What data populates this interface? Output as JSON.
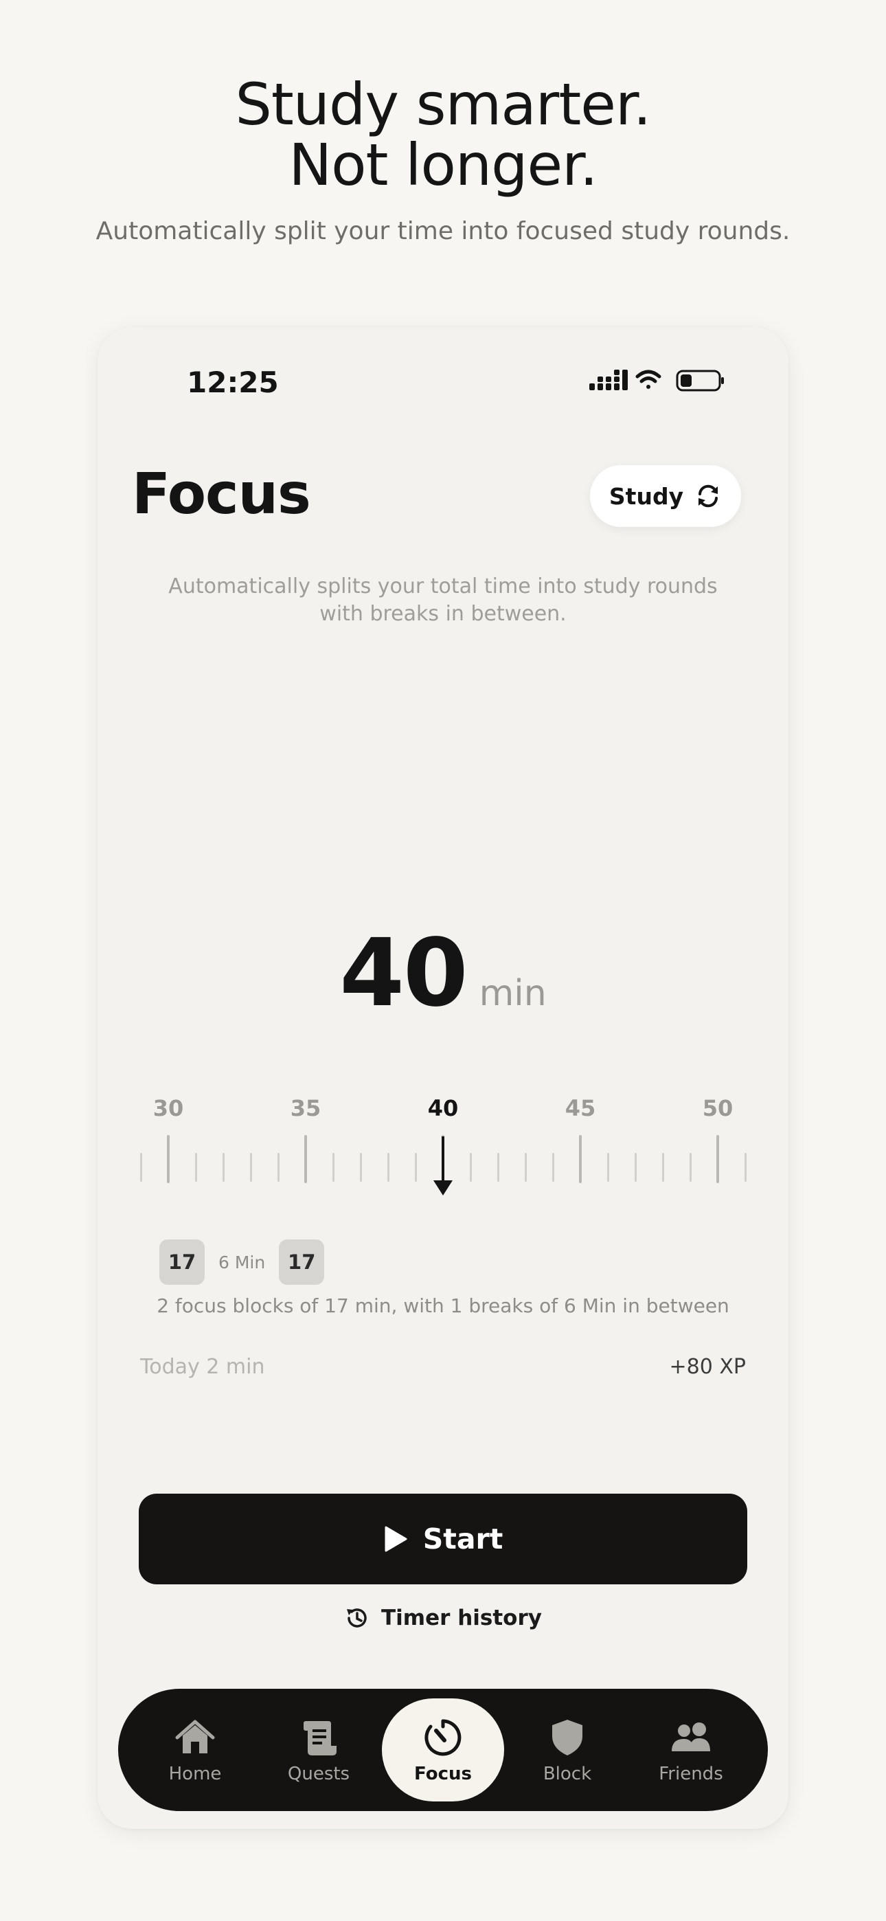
{
  "marketing": {
    "headline_line1": "Study smarter.",
    "headline_line2": "Not longer.",
    "subline": "Automatically split your time into focused study rounds."
  },
  "status_bar": {
    "time": "12:25",
    "icons": [
      "signal-icon",
      "wifi-icon",
      "battery-icon"
    ]
  },
  "header": {
    "title": "Focus",
    "mode_label": "Study",
    "mode_icon": "refresh-icon"
  },
  "description": "Automatically splits your total time into study rounds with breaks in between.",
  "timer": {
    "value": "40",
    "unit": "min"
  },
  "ruler": {
    "labels": [
      "30",
      "35",
      "40",
      "45",
      "50"
    ],
    "selected": "40",
    "min": 29,
    "max": 51
  },
  "blocks": {
    "focus_1": "17",
    "break": "6 Min",
    "focus_2": "17",
    "summary": "2 focus blocks of 17 min, with 1 breaks of 6 Min in between"
  },
  "stats": {
    "today": "Today 2 min",
    "xp": "+80 XP"
  },
  "actions": {
    "start_label": "Start",
    "history_label": "Timer history"
  },
  "tabbar": {
    "items": [
      {
        "label": "Home",
        "icon": "home-icon"
      },
      {
        "label": "Quests",
        "icon": "scroll-icon"
      },
      {
        "label": "Focus",
        "icon": "timer-icon",
        "active": true
      },
      {
        "label": "Block",
        "icon": "shield-icon"
      },
      {
        "label": "Friends",
        "icon": "people-icon"
      }
    ]
  },
  "colors": {
    "background": "#f7f6f2",
    "card": "#f3f2ef",
    "dark": "#151412",
    "accent_light": "#f5f3ec"
  }
}
